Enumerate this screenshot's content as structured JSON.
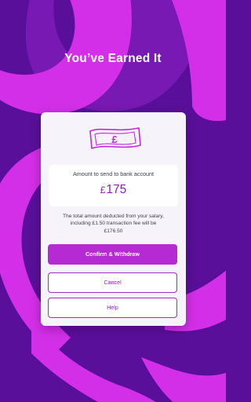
{
  "header": {
    "title": "You’ve Earned It"
  },
  "card": {
    "icon": "banknote-icon",
    "amount_label": "Amount to send to bank account",
    "amount_currency": "£",
    "amount_value": "175",
    "description_line1": "The total amount deducted from your salary,",
    "description_line2": "including £1.50 transaction fee will be",
    "description_line3": "£176.50",
    "confirm_label": "Confirm & Withdraw",
    "cancel_label": "Cancel",
    "help_label": "Help"
  },
  "colors": {
    "background": "#5a0f9a",
    "swirl": "#d42fe8",
    "accent": "#b62ad3",
    "amount_text": "#8a1fc6"
  }
}
